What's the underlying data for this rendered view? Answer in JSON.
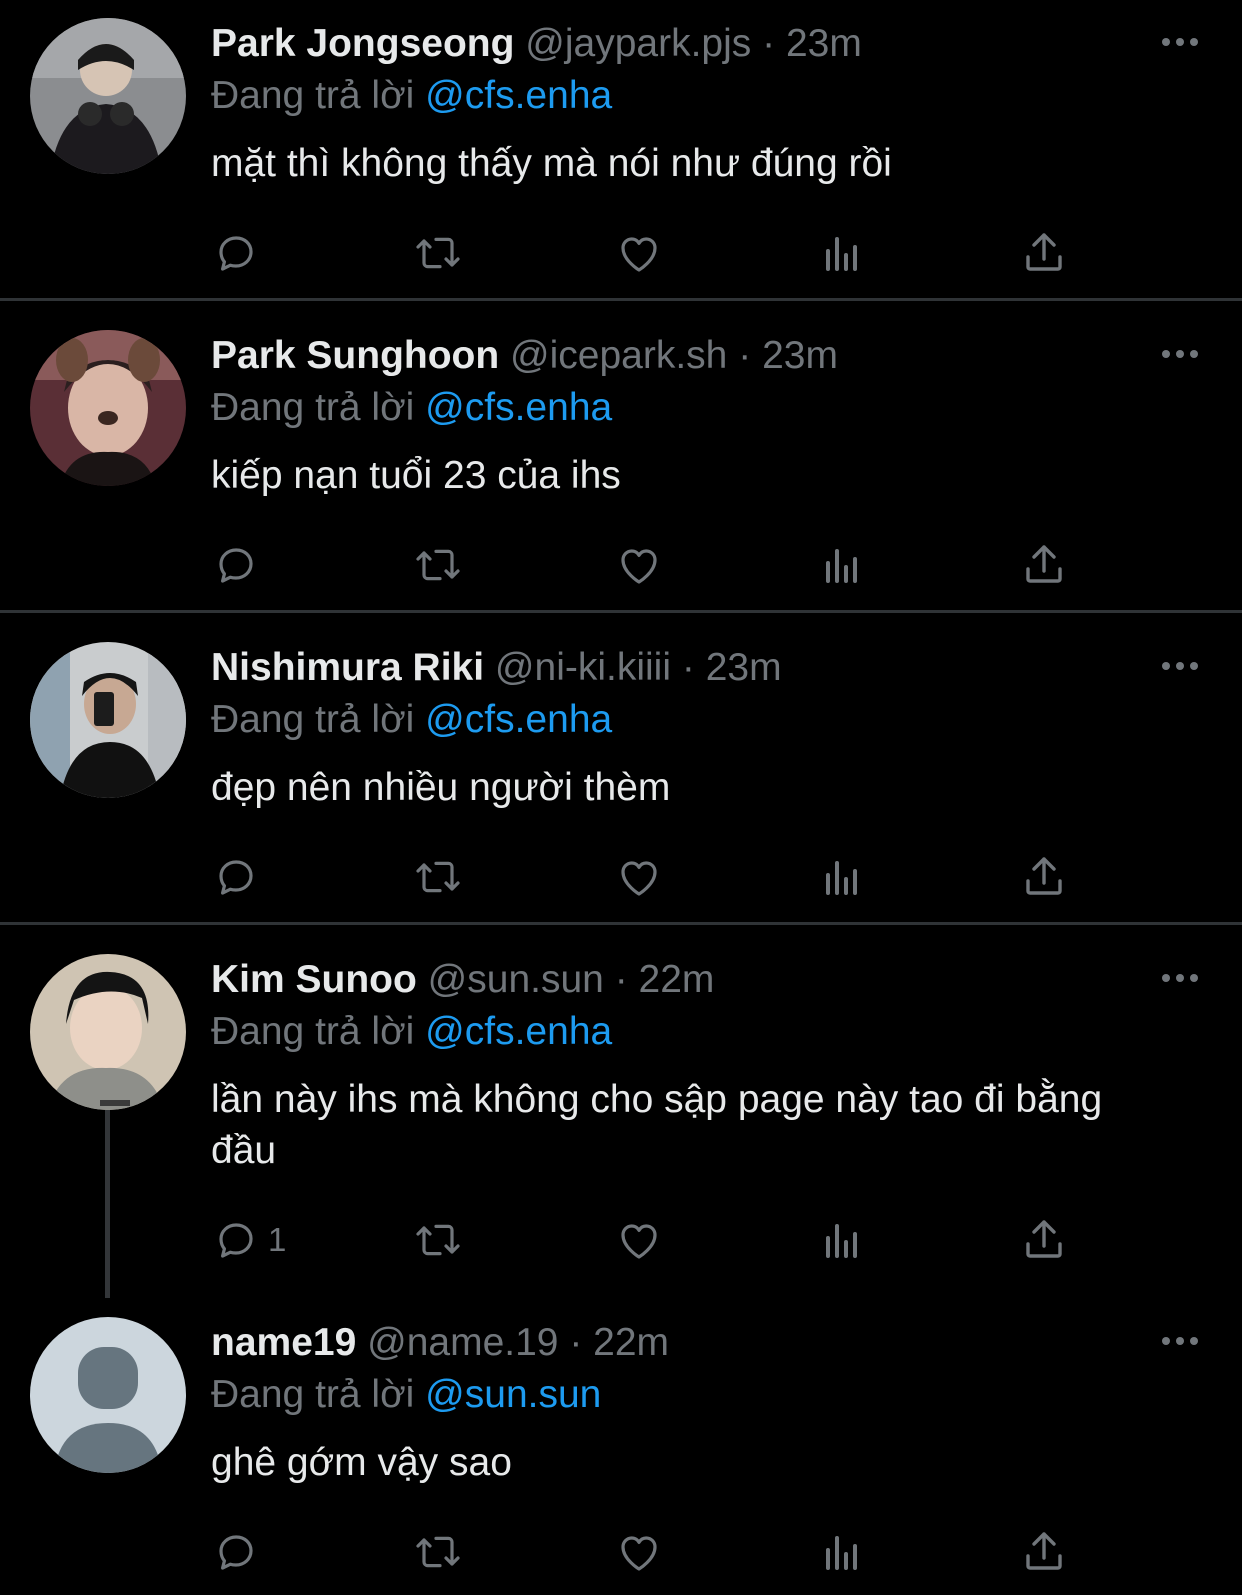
{
  "tweets": [
    {
      "name": "Park Jongseong",
      "handle": "@jaypark.pjs",
      "separator": "·",
      "time": "23m",
      "reply_prefix": "Đang trả lời",
      "reply_to": "@cfs.enha",
      "text": "mặt thì không thấy mà nói như đúng rồi",
      "reply_count": ""
    },
    {
      "name": "Park Sunghoon",
      "handle": "@icepark.sh",
      "separator": "·",
      "time": "23m",
      "reply_prefix": "Đang trả lời",
      "reply_to": "@cfs.enha",
      "text": "kiếp nạn tuổi 23 của ihs",
      "reply_count": ""
    },
    {
      "name": "Nishimura Riki",
      "handle": "@ni-ki.kiiii",
      "separator": "·",
      "time": "23m",
      "reply_prefix": "Đang trả lời",
      "reply_to": "@cfs.enha",
      "text": "đẹp nên nhiều người thèm",
      "reply_count": ""
    },
    {
      "name": "Kim Sunoo",
      "handle": "@sun.sun",
      "separator": "·",
      "time": "22m",
      "reply_prefix": "Đang trả lời",
      "reply_to": "@cfs.enha",
      "text": "lần này ihs mà không cho sập page này tao đi bằng đầu",
      "reply_count": "1"
    },
    {
      "name": "name19",
      "handle": "@name.19",
      "separator": "·",
      "time": "22m",
      "reply_prefix": "Đang trả lời",
      "reply_to": "@sun.sun",
      "text": "ghê gớm vậy sao",
      "reply_count": ""
    }
  ],
  "icons": {
    "reply": "reply-icon",
    "retweet": "retweet-icon",
    "like": "heart-icon",
    "views": "views-icon",
    "share": "share-icon",
    "more": "more-icon"
  },
  "colors": {
    "background": "#000000",
    "text": "#e7e9ea",
    "secondary": "#71767b",
    "link": "#1d9bf0",
    "divider": "#2f3336"
  }
}
